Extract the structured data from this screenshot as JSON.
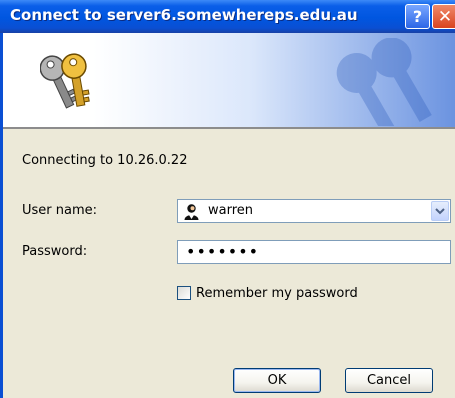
{
  "window": {
    "title": "Connect to server6.somewhereps.edu.au",
    "help_label": "?",
    "close_label": "✕"
  },
  "banner": {
    "icon": "keys-icon"
  },
  "dialog": {
    "connecting_text": "Connecting to 10.26.0.22",
    "username_label": "User name:",
    "username_value": "warren",
    "password_label": "Password:",
    "password_value": "•••••••",
    "remember_label": "Remember my password",
    "remember_checked": false
  },
  "buttons": {
    "ok_label": "OK",
    "cancel_label": "Cancel"
  },
  "colors": {
    "titlebar": "#0054e3",
    "dialog_bg": "#ece9d8",
    "field_border": "#7f9db9"
  }
}
